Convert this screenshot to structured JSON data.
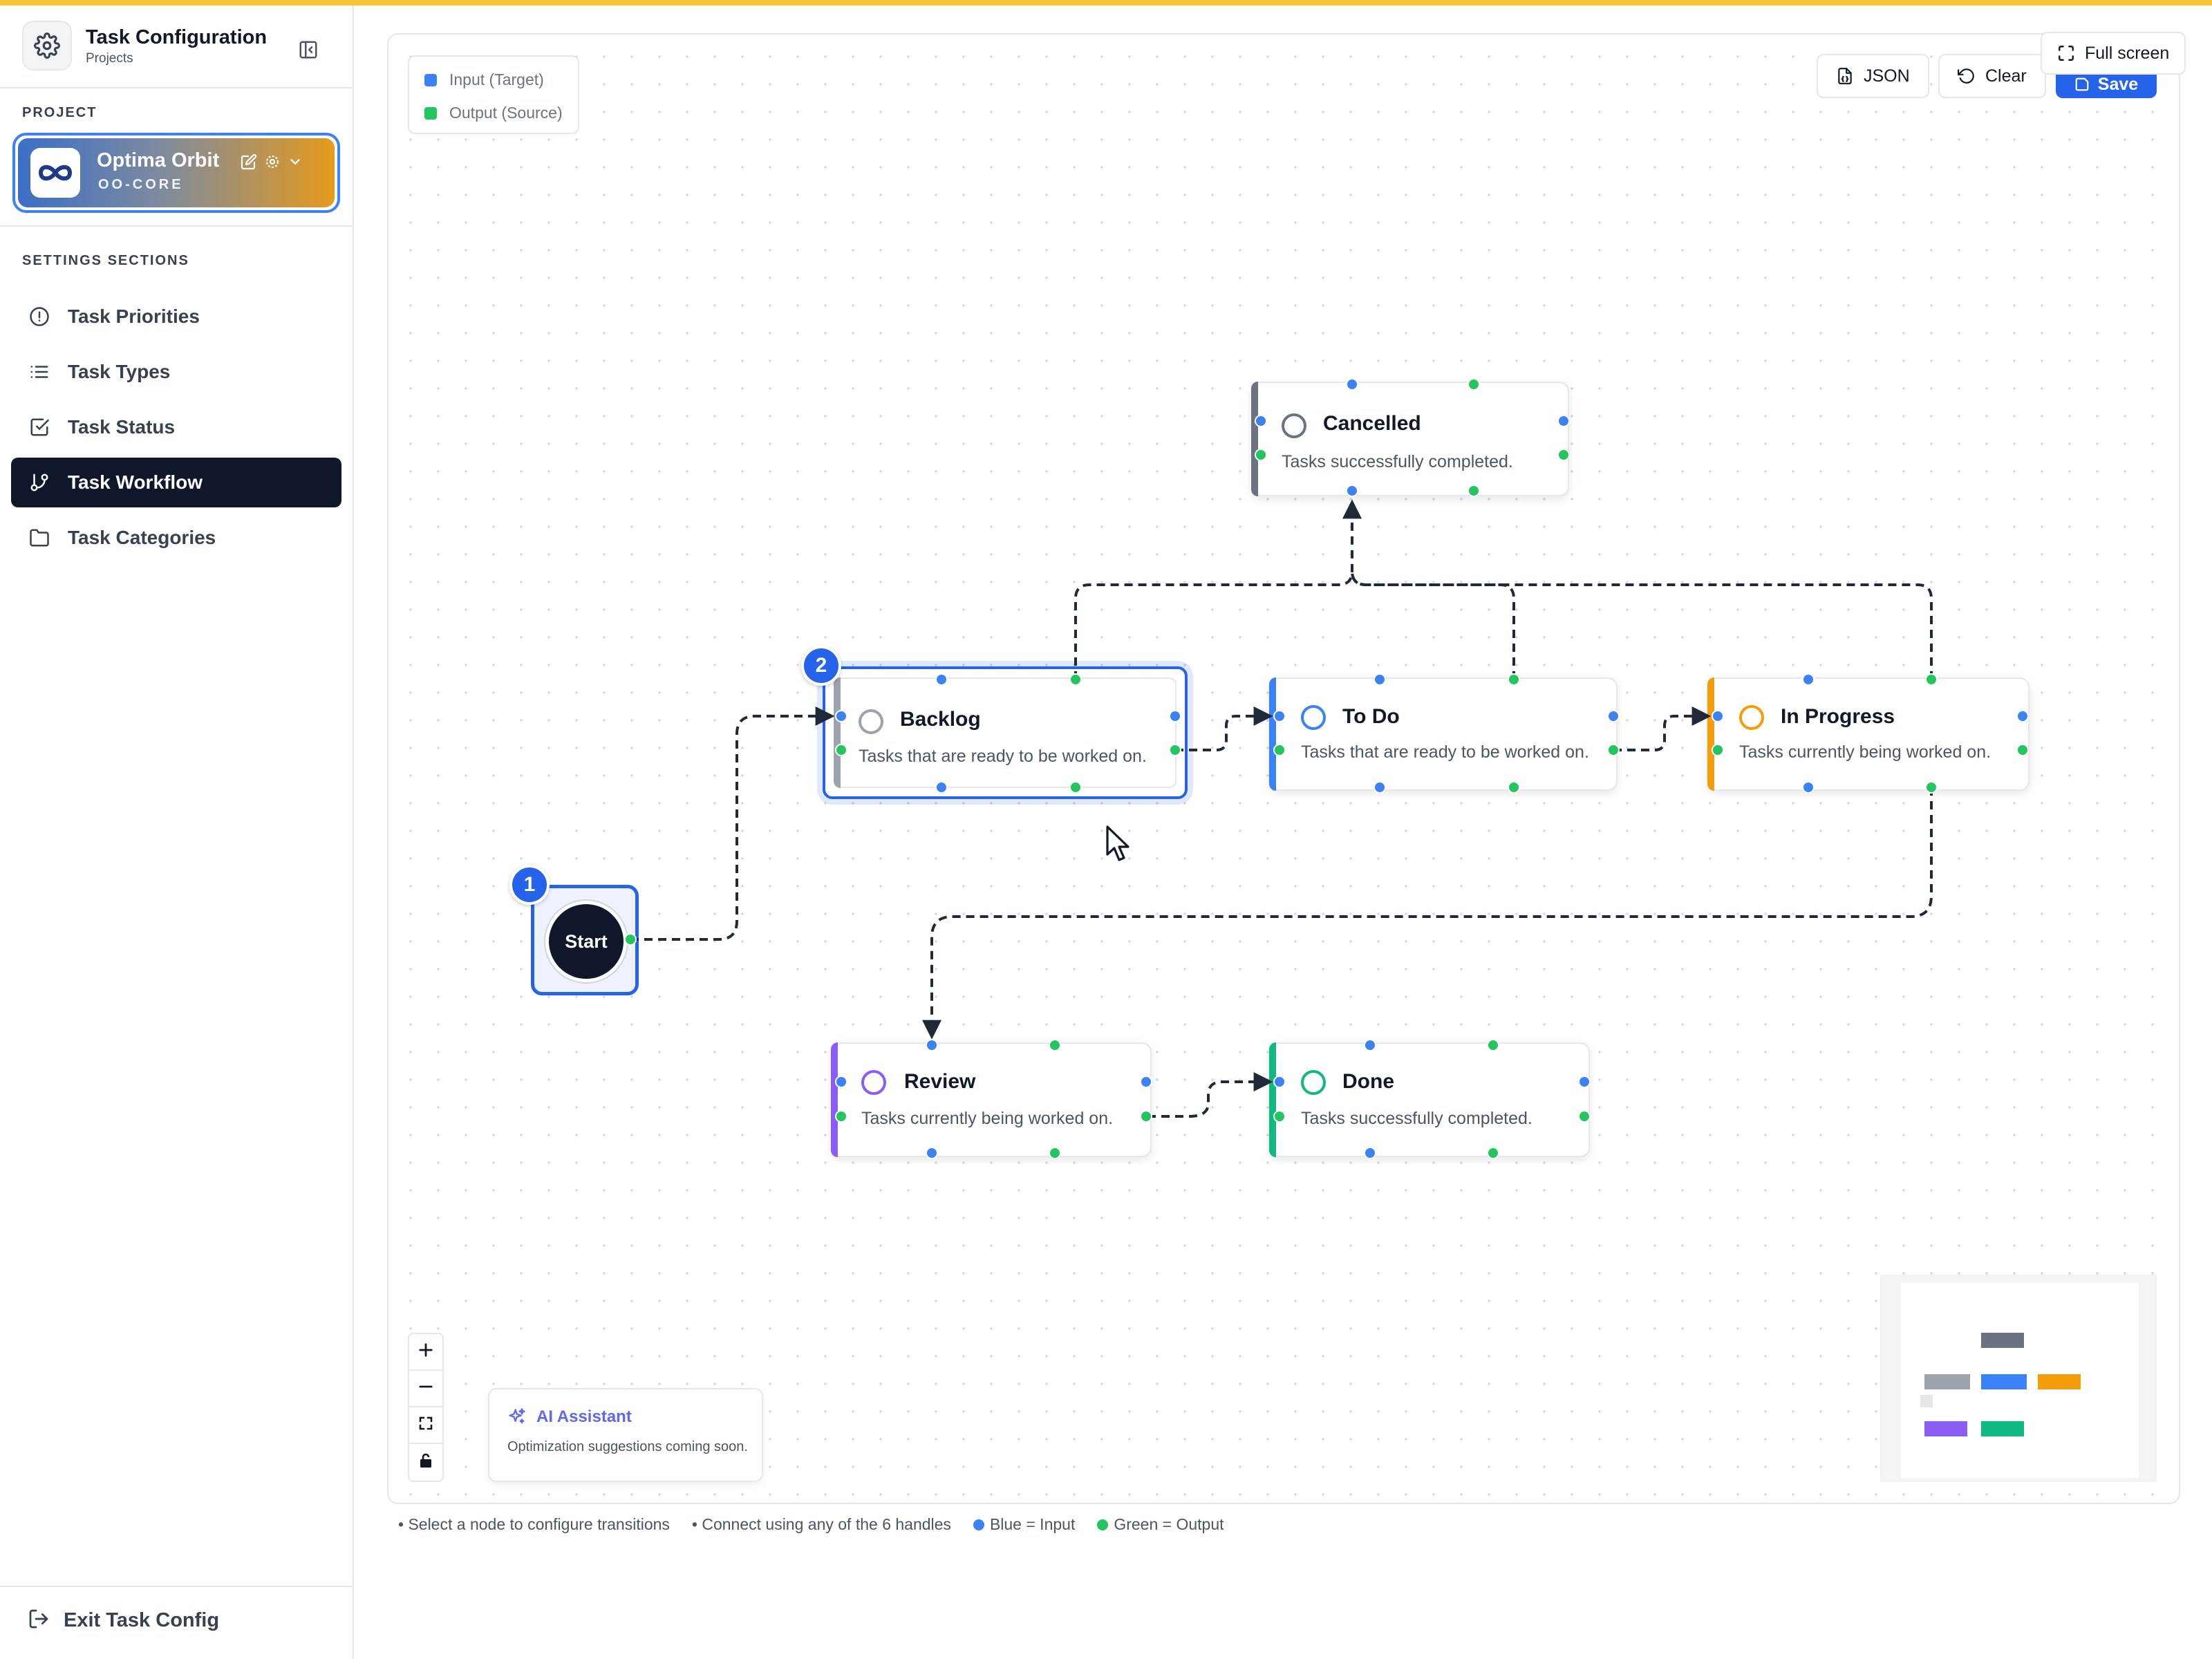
{
  "sidebar": {
    "title": "Task Configuration",
    "subtitle": "Projects",
    "project_section_label": "PROJECT",
    "project": {
      "name": "Optima Orbit",
      "code": "OO-CORE"
    },
    "settings_section_label": "SETTINGS SECTIONS",
    "nav": [
      {
        "label": "Task Priorities",
        "icon": "alert-circle-icon",
        "active": false
      },
      {
        "label": "Task Types",
        "icon": "list-icon",
        "active": false
      },
      {
        "label": "Task Status",
        "icon": "check-square-icon",
        "active": false
      },
      {
        "label": "Task Workflow",
        "icon": "git-branch-icon",
        "active": true
      },
      {
        "label": "Task Categories",
        "icon": "folder-icon",
        "active": false
      }
    ],
    "exit_label": "Exit Task Config"
  },
  "legend": {
    "input_label": "Input (Target)",
    "output_label": "Output (Source)"
  },
  "toolbar": {
    "json_label": "JSON",
    "clear_label": "Clear",
    "save_label": "Save",
    "fullscreen_label": "Full screen"
  },
  "colors": {
    "input_handle": "#3b82f6",
    "output_handle": "#22c55e",
    "accent": "#2563eb",
    "nav_active_bg": "#0f172a",
    "status_backlog": "#9ca3af",
    "status_cancelled": "#6b7280",
    "status_todo": "#3b82f6",
    "status_inprogress": "#f59e0b",
    "status_review": "#8b5cf6",
    "status_done": "#10b981"
  },
  "workflow": {
    "start_label": "Start",
    "badges": {
      "start": "1",
      "backlog": "2"
    },
    "nodes": [
      {
        "id": "cancelled",
        "title": "Cancelled",
        "description": "Tasks successfully completed."
      },
      {
        "id": "backlog",
        "title": "Backlog",
        "description": "Tasks that are ready to be worked on.",
        "selected": true
      },
      {
        "id": "todo",
        "title": "To Do",
        "description": "Tasks that are ready to be worked on."
      },
      {
        "id": "inprogress",
        "title": "In Progress",
        "description": "Tasks currently being worked on."
      },
      {
        "id": "review",
        "title": "Review",
        "description": "Tasks currently being worked on."
      },
      {
        "id": "done",
        "title": "Done",
        "description": "Tasks successfully completed."
      }
    ]
  },
  "ai_assistant": {
    "title": "AI Assistant",
    "subtitle": "Optimization suggestions coming soon."
  },
  "hints": {
    "select": "• Select a node to configure transitions",
    "connect": "• Connect using any of the 6 handles",
    "blue": "Blue = Input",
    "green": "Green = Output"
  }
}
